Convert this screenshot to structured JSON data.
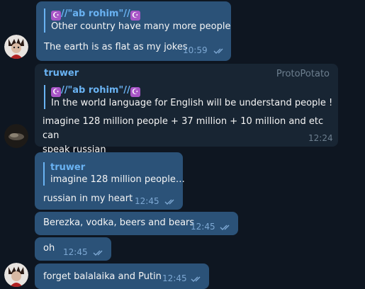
{
  "messages": [
    {
      "reply_name": "//\"ab rohim\"//",
      "reply_text": "Other country have many more people",
      "text": "The earth is as flat as my jokes",
      "time": "10:59"
    },
    {
      "sender": "truwer",
      "signature": "ProtoPotato",
      "reply_name": "//\"ab rohim\"//",
      "reply_text": "In the world language for English will be understand people !",
      "text_line1": "imagine 128 million people + 37 million + 10 million and etc can",
      "text_line2": "speak russian",
      "time": "12:24"
    },
    {
      "reply_name": "truwer",
      "reply_text": "imagine 128 million people…",
      "text": "russian in my heart",
      "time": "12:45"
    },
    {
      "text": "Berezka, vodka, beers and bears",
      "time": "12:45"
    },
    {
      "text": "oh",
      "time": "12:45"
    },
    {
      "text": "forget balalaika and Putin",
      "time": "12:45"
    }
  ],
  "icons": {
    "moon": "☪",
    "read_ticks": "double-check-icon"
  },
  "colors": {
    "background": "#0e1621",
    "outgoing_bubble": "#2b5278",
    "incoming_bubble": "#182533",
    "accent": "#6ab3f3"
  }
}
